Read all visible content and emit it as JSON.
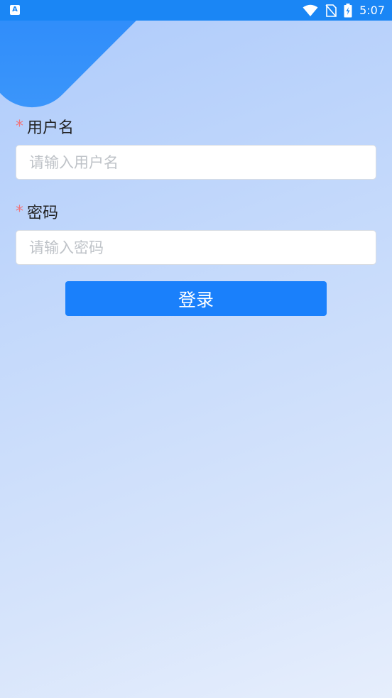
{
  "status_bar": {
    "left_icon": "A",
    "time": "5:07",
    "icons": [
      "wifi-icon",
      "no-sim-icon",
      "battery-charging-icon"
    ]
  },
  "form": {
    "username": {
      "label": "用户名",
      "required_mark": "*",
      "placeholder": "请输入用户名",
      "value": ""
    },
    "password": {
      "label": "密码",
      "required_mark": "*",
      "placeholder": "请输入密码",
      "value": ""
    },
    "login_label": "登录"
  },
  "colors": {
    "status_bar": "#1a86f5",
    "button": "#1a80fb",
    "required_star": "#f0747a",
    "background_top": "#aecbfb",
    "background_bottom": "#e6eefc"
  }
}
